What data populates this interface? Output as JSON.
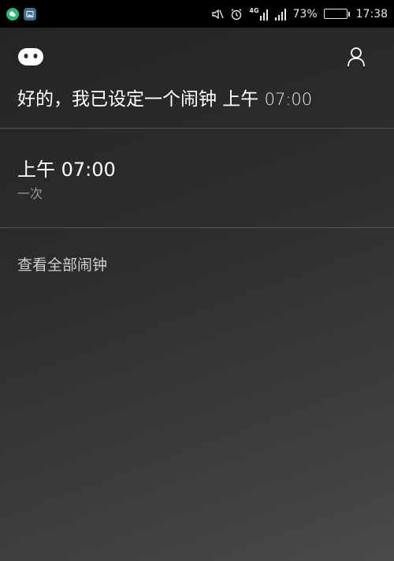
{
  "status_bar": {
    "notification_icons": [
      "wechat-icon",
      "gallery-icon"
    ],
    "network": "4G",
    "battery_percent": "73%",
    "battery_level": 0.73,
    "time": "17:38"
  },
  "assistant": {
    "response_text": "好的，我已设定一个闹钟 上午 ",
    "response_time": "07:00"
  },
  "alarm": {
    "time": "上午 07:00",
    "repeat": "一次"
  },
  "view_all_label": "查看全部闹钟"
}
